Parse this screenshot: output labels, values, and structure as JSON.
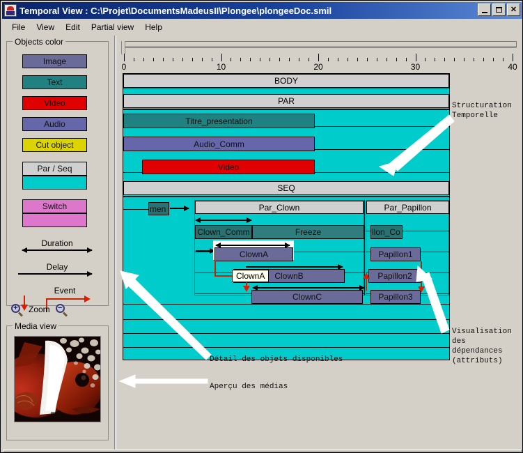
{
  "window": {
    "title": "Temporal View : C:\\Projet\\DocumentsMadeusII\\Plongee\\plongeeDoc.smil",
    "icon": "app-icon",
    "buttons": {
      "minimize": "_",
      "maximize": "□",
      "close": "✕"
    }
  },
  "menu": {
    "items": [
      {
        "label": "File"
      },
      {
        "label": "View"
      },
      {
        "label": "Edit"
      },
      {
        "label": "Partial view"
      },
      {
        "label": "Help"
      }
    ]
  },
  "legend": {
    "title": "Objects color",
    "swatches": [
      {
        "label": "Image",
        "color": "#6b6b99"
      },
      {
        "label": "Text",
        "color": "#218080"
      },
      {
        "label": "Video",
        "color": "#e00000"
      },
      {
        "label": "Audio",
        "color": "#6666aa"
      },
      {
        "label": "Cut object",
        "color": "#dcd400"
      },
      {
        "label": "Par / Seq",
        "color": "#d0d0d0"
      },
      {
        "label": "",
        "color": "#00cccc"
      },
      {
        "label": "Switch",
        "color": "#dd77cc"
      },
      {
        "label": "",
        "color": "#dd77cc"
      }
    ],
    "relations": [
      {
        "label": "Duration",
        "kind": "double-arrow",
        "color": "#000000"
      },
      {
        "label": "Delay",
        "kind": "single-arrow",
        "color": "#000000"
      },
      {
        "label": "Event",
        "kind": "event-arrow",
        "color": "#cc2200"
      }
    ],
    "zoom": {
      "label": "Zoom",
      "in_icon": "zoom-in-icon",
      "out_icon": "zoom-out-icon",
      "in_sign": "+",
      "out_sign": "−"
    }
  },
  "media_view": {
    "title": "Media view",
    "image_alt": "clownfish-photo"
  },
  "timeline": {
    "ruler": {
      "min": 0,
      "max": 40,
      "major_ticks": [
        0,
        10,
        20,
        30,
        40
      ],
      "major_labels": [
        "0",
        "10",
        "20",
        "30",
        "40"
      ],
      "minor_step": 1
    },
    "rows": [
      {
        "id": "body",
        "label": "BODY",
        "type": "container-header"
      },
      {
        "id": "par",
        "label": "PAR",
        "type": "container-header"
      },
      {
        "id": "titre_presentation",
        "label": "Titre_presentation",
        "type": "text",
        "start": 0,
        "end": 23.2
      },
      {
        "id": "audio_comm",
        "label": "Audio_Comm",
        "type": "audio",
        "start": 0,
        "end": 23.2
      },
      {
        "id": "video",
        "label": "Video",
        "type": "video",
        "start": 2.4,
        "end": 23.2
      },
      {
        "id": "seq",
        "label": "SEQ",
        "type": "container-header"
      }
    ],
    "seq_children": [
      {
        "id": "par_clown",
        "label": "Par_Clown",
        "type": "container-header",
        "children": [
          {
            "id": "clown_comm",
            "label": "Clown_Comm",
            "type": "text"
          },
          {
            "id": "freeze",
            "label": "Freeze",
            "type": "text"
          },
          {
            "id": "clown_a",
            "label": "ClownA",
            "type": "image"
          },
          {
            "id": "clown_b",
            "label": "ClownB",
            "type": "image"
          },
          {
            "id": "clown_c",
            "label": "ClownC",
            "type": "image"
          }
        ]
      },
      {
        "id": "par_papillon",
        "label": "Par_Papillon",
        "type": "container-header",
        "children": [
          {
            "id": "papillon_comm",
            "label": "llon_Co",
            "type": "text"
          },
          {
            "id": "papillon1",
            "label": "Papillon1",
            "type": "image"
          },
          {
            "id": "papillon2",
            "label": "Papillon2",
            "type": "image"
          },
          {
            "id": "papillon3",
            "label": "Papillon3",
            "type": "image"
          }
        ]
      }
    ],
    "clipped_block": {
      "id": "documen",
      "label": "men",
      "type": "text"
    },
    "tooltip": {
      "label": "ClownA"
    }
  },
  "annotations": [
    {
      "id": "structuration",
      "text": "Structuration\nTemporelle"
    },
    {
      "id": "visualisation",
      "text": "Visualisation\ndes\ndépendances\n(attributs)"
    },
    {
      "id": "detail-objets",
      "text": "Détail des objets disponibles"
    },
    {
      "id": "apercu-medias",
      "text": "Aperçu des médias"
    }
  ],
  "colors": {
    "window_bg": "#d4d0c8",
    "title_start": "#0a246a",
    "title_end": "#5b8ad6",
    "timeline_bg": "#00cccc",
    "container_header": "#d0d0d0",
    "text_object": "#218080",
    "image_object": "#6b6b99",
    "audio_object": "#6666aa",
    "video_object": "#e00000",
    "event_red": "#cc2200"
  }
}
